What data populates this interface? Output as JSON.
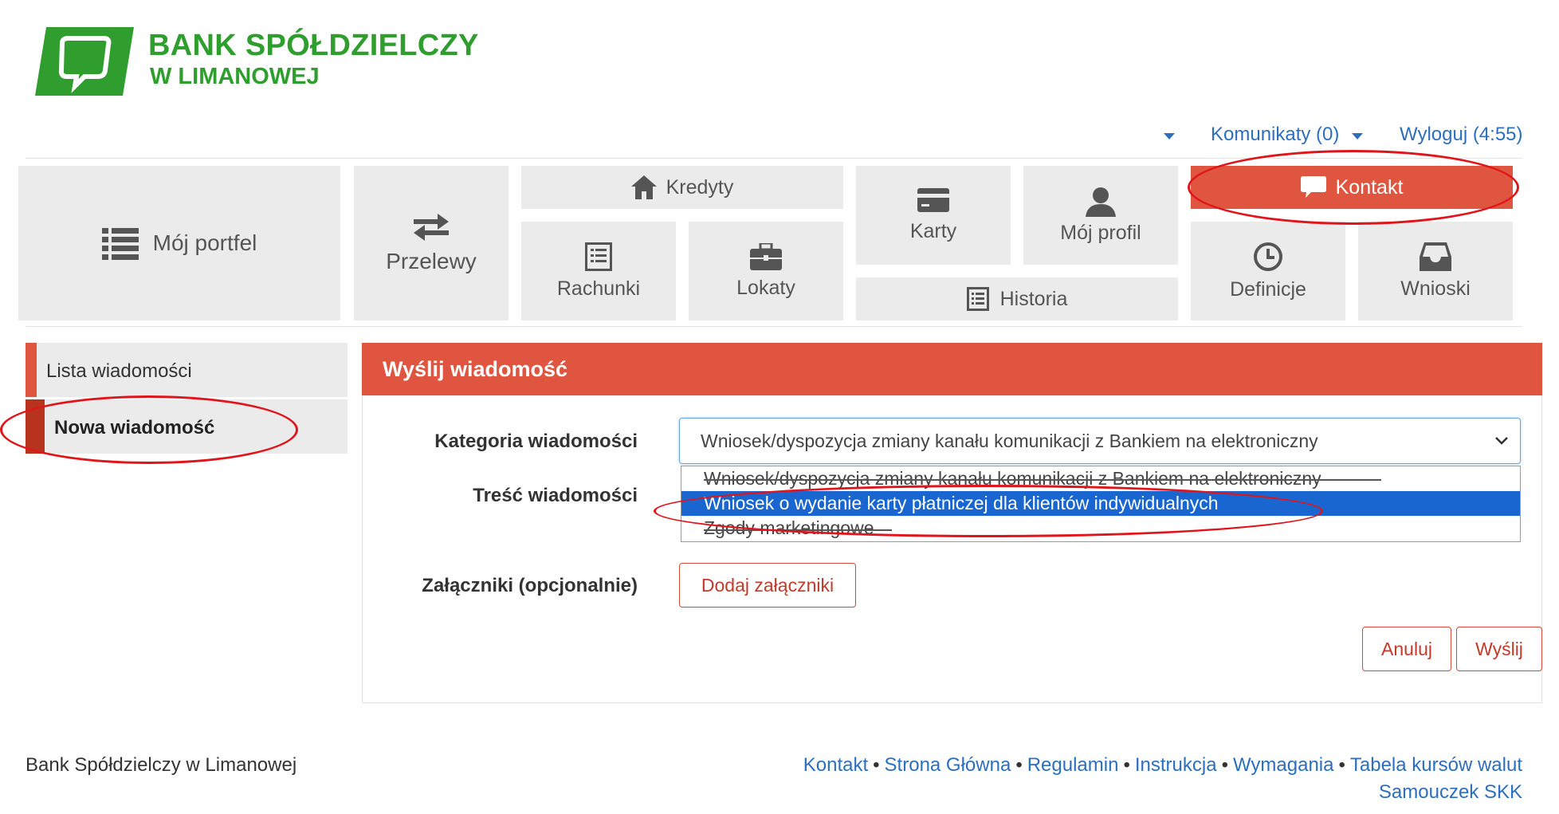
{
  "brand": {
    "name_line1": "BANK SPÓŁDZIELCZY",
    "name_line2": "W LIMANOWEJ",
    "color": "#2f9e2e"
  },
  "topbar": {
    "komunikaty_label": "Komunikaty (0)",
    "logout_label": "Wyloguj (4:55)"
  },
  "nav": {
    "moj_portfel": "Mój portfel",
    "przelewy": "Przelewy",
    "kredyty": "Kredyty",
    "rachunki": "Rachunki",
    "lokaty": "Lokaty",
    "karty": "Karty",
    "historia": "Historia",
    "moj_profil": "Mój profil",
    "kontakt": "Kontakt",
    "definicje": "Definicje",
    "wnioski": "Wnioski",
    "accent_color": "#e0553f"
  },
  "sidebar": {
    "items": [
      {
        "label": "Lista wiadomości",
        "active": false
      },
      {
        "label": "Nowa wiadomość",
        "active": true
      }
    ]
  },
  "form": {
    "title": "Wyślij wiadomość",
    "category_label": "Kategoria wiadomości",
    "category_value": "Wniosek/dyspozycja zmiany kanału komunikacji z Bankiem na elektroniczny",
    "category_options": [
      "Wniosek/dyspozycja zmiany kanału komunikacji z Bankiem na elektroniczny",
      "Wniosek o wydanie karty płatniczej dla klientów indywidualnych",
      "Zgody marketingowe"
    ],
    "highlighted_option_index": 1,
    "content_label": "Treść wiadomości",
    "attachments_label": "Załączniki (opcjonalnie)",
    "add_attachments_button": "Dodaj załączniki",
    "cancel_button": "Anuluj",
    "send_button": "Wyślij"
  },
  "footer": {
    "bank_name": "Bank Spółdzielczy w Limanowej",
    "links": [
      "Kontakt",
      "Strona Główna",
      "Regulamin",
      "Instrukcja",
      "Wymagania",
      "Tabela kursów walut"
    ],
    "links_line2": "Samouczek SKK",
    "separator": "•"
  }
}
